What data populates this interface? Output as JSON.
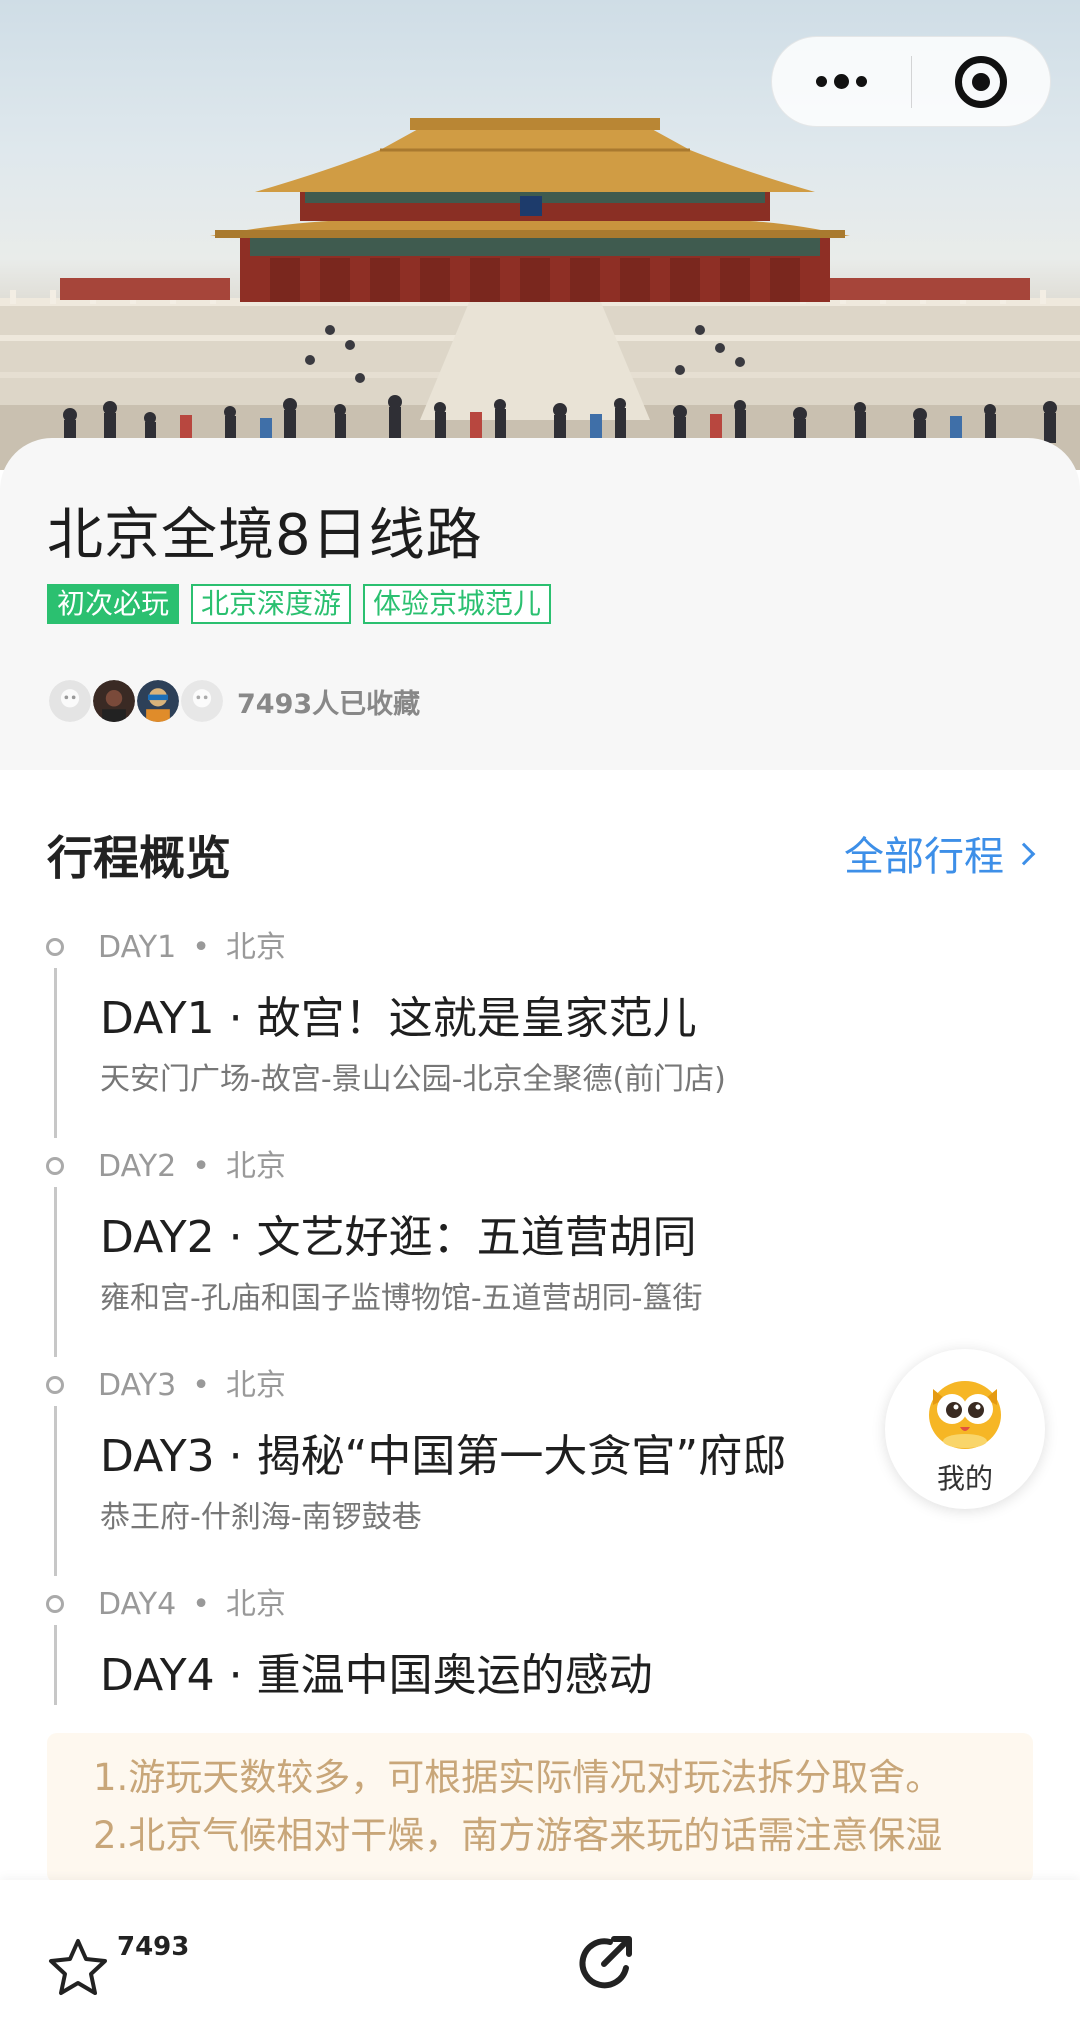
{
  "capsule": {
    "more_icon": "more-dots-icon",
    "close_icon": "target-close-icon"
  },
  "route": {
    "title": "北京全境8日线路",
    "tags": [
      {
        "label": "初次必玩",
        "style": "filled"
      },
      {
        "label": "北京深度游",
        "style": "outline"
      },
      {
        "label": "体验京城范儿",
        "style": "outline"
      }
    ],
    "favorites_text": "7493人已收藏"
  },
  "overview": {
    "title": "行程概览",
    "all_link": "全部行程",
    "days": [
      {
        "day": "DAY1",
        "city": "北京",
        "dot": "•",
        "heading": "DAY1 · 故宫！这就是皇家范儿",
        "places": "天安门广场-故宫-景山公园-北京全聚德(前门店)"
      },
      {
        "day": "DAY2",
        "city": "北京",
        "dot": "•",
        "heading": "DAY2 · 文艺好逛：五道营胡同",
        "places": "雍和宫-孔庙和国子监博物馆-五道营胡同-簋街"
      },
      {
        "day": "DAY3",
        "city": "北京",
        "dot": "•",
        "heading": "DAY3 · 揭秘“中国第一大贪官”府邸",
        "places": "恭王府-什刹海-南锣鼓巷"
      },
      {
        "day": "DAY4",
        "city": "北京",
        "dot": "•",
        "heading": "DAY4 · 重温中国奥运的感动",
        "places": ""
      }
    ]
  },
  "notes": [
    "1.游玩天数较多，可根据实际情况对玩法拆分取舍。",
    "2.北京气候相对干燥，南方游客来玩的话需注意保湿"
  ],
  "floating": {
    "label": "我的",
    "icon": "owl-mascot-icon"
  },
  "bottom_bar": {
    "favorite_count": "7493",
    "star_icon": "star-icon",
    "share_icon": "share-icon"
  },
  "colors": {
    "tag_green": "#2bc070",
    "link_blue": "#3d8fe8",
    "note_text": "#c8a679",
    "note_bg": "#fef8ef"
  }
}
